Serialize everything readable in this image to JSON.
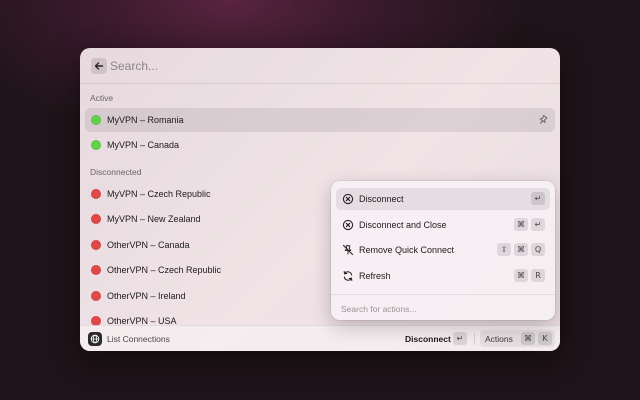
{
  "search": {
    "placeholder": "Search..."
  },
  "sections": {
    "active": "Active",
    "disconnected": "Disconnected"
  },
  "active_connections": [
    {
      "label": "MyVPN – Romania",
      "status": "connected",
      "color": "#62d24a",
      "selected": true
    },
    {
      "label": "MyVPN – Canada",
      "status": "connected",
      "color": "#62d24a"
    }
  ],
  "disconnected_connections": [
    {
      "label": "MyVPN – Czech Republic",
      "status": "disconnected",
      "color": "#e14848"
    },
    {
      "label": "MyVPN – New Zealand",
      "status": "disconnected",
      "color": "#e14848"
    },
    {
      "label": "OtherVPN – Canada",
      "status": "disconnected",
      "color": "#e14848"
    },
    {
      "label": "OtherVPN – Czech Republic",
      "status": "disconnected",
      "color": "#e14848"
    },
    {
      "label": "OtherVPN – Ireland",
      "status": "disconnected",
      "color": "#e14848"
    },
    {
      "label": "OtherVPN – USA",
      "status": "disconnected",
      "color": "#e14848"
    }
  ],
  "footer": {
    "title": "List Connections",
    "primary_action": "Disconnect",
    "primary_shortcut": "↵",
    "actions_label": "Actions",
    "actions_shortcut_mod": "⌘",
    "actions_shortcut_key": "K"
  },
  "actions_menu": {
    "items": [
      {
        "label": "Disconnect",
        "icon": "x-circle-icon",
        "keys": [
          "↵"
        ],
        "selected": true
      },
      {
        "label": "Disconnect and Close",
        "icon": "x-circle-icon",
        "keys": [
          "⌘",
          "↵"
        ]
      },
      {
        "label": "Remove Quick Connect",
        "icon": "pin-slash-icon",
        "keys": [
          "⇧",
          "⌘",
          "Q"
        ]
      },
      {
        "label": "Refresh",
        "icon": "refresh-icon",
        "keys": [
          "⌘",
          "R"
        ]
      }
    ],
    "search_placeholder": "Search for actions..."
  }
}
